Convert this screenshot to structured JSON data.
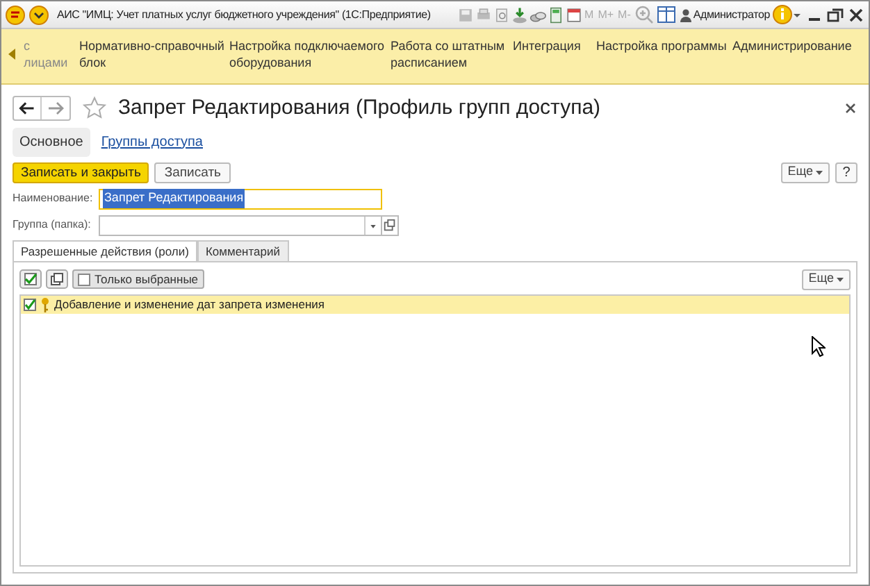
{
  "window": {
    "title": "АИС \"ИМЦ: Учет платных услуг бюджетного учреждения\"  (1С:Предприятие)",
    "memory_buttons": [
      "M",
      "M+",
      "M-"
    ],
    "user": "Администратор"
  },
  "sections": [
    {
      "label": "с\nлицами"
    },
    {
      "label": "Нормативно-справочный\nблок"
    },
    {
      "label": "Настройка подключаемого\nоборудования"
    },
    {
      "label": "Работа со штатным\nрасписанием"
    },
    {
      "label": "Интеграция"
    },
    {
      "label": "Настройка программы"
    },
    {
      "label": "Администрирование"
    }
  ],
  "form": {
    "title": "Запрет Редактирования (Профиль групп доступа)",
    "favorite": false,
    "nav": [
      {
        "label": "Основное",
        "selected": true
      },
      {
        "label": "Группы доступа",
        "selected": false
      }
    ],
    "buttons": {
      "save_close": "Записать и закрыть",
      "save": "Записать",
      "more": "Еще",
      "help": "?"
    },
    "fields": [
      {
        "label": "Наименование:",
        "value": "Запрет Редактирования",
        "focused": true,
        "kind": "text"
      },
      {
        "label": "Группа (папка):",
        "focused": false,
        "kind": "select"
      }
    ],
    "tabs": [
      {
        "label": "Разрешенные действия (роли)",
        "selected": true
      },
      {
        "label": "Комментарий",
        "selected": false
      }
    ],
    "table_toolbar": {
      "only_selected": "Только выбранные",
      "only_selected_on": false,
      "more": "Еще"
    },
    "rows": [
      {
        "label": "Добавление и изменение дат запрета изменения",
        "checked": true,
        "selected": true
      }
    ]
  }
}
